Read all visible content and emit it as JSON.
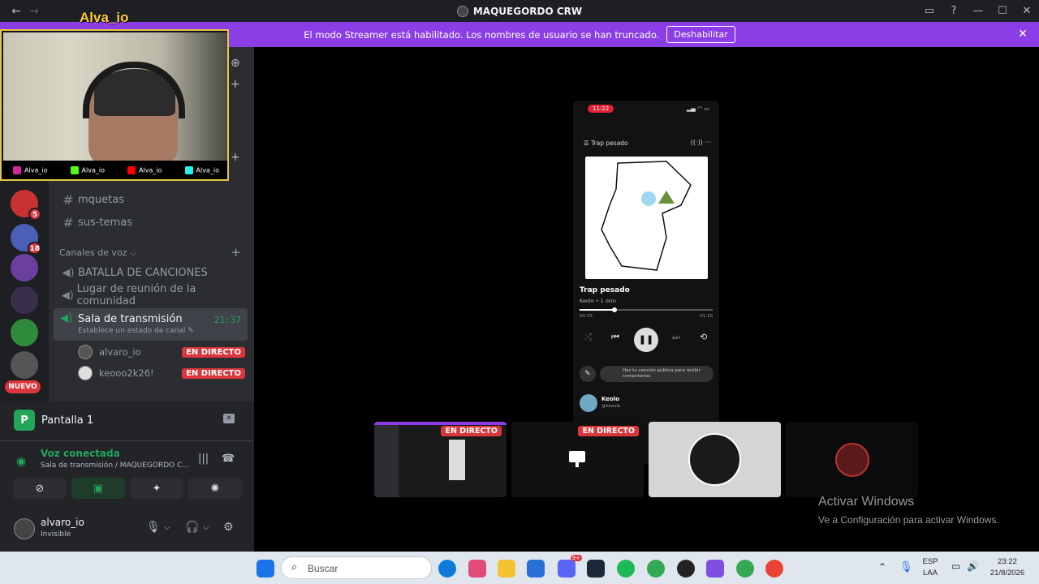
{
  "window": {
    "title": "MAQUEGORDO CRW",
    "back": "←",
    "forward": "→",
    "controls": [
      "▭",
      "?",
      "—",
      "☐",
      "✕"
    ]
  },
  "overlay": {
    "brand": "Alva_io",
    "socials": [
      "Alva_io",
      "Alva_io",
      "Alva_io",
      "Alva_io"
    ]
  },
  "banner": {
    "text": "El modo Streamer está habilitado. Los nombres de usuario se han truncado.",
    "button": "Deshabilitar",
    "close": "✕"
  },
  "servers": {
    "badges": [
      "5",
      "18"
    ],
    "new_label": "NUEVO"
  },
  "channels": {
    "text": [
      {
        "name": "mquetas"
      },
      {
        "name": "sus-temas"
      }
    ],
    "voice_category": "Canales de voz ⌵",
    "add": "+",
    "voice": [
      {
        "name": "BATALLA DE CANCIONES"
      },
      {
        "name": "Lugar de reunión de la comunidad"
      }
    ],
    "active": {
      "name": "Sala de transmisión",
      "time": "21:37",
      "status": "Establece un estado de canal ✎"
    },
    "members": [
      {
        "name": "alvaro_io",
        "badge": "EN DIRECTO"
      },
      {
        "name": "keooo2k26!",
        "badge": "EN DIRECTO"
      }
    ]
  },
  "panel": {
    "screen_label": "Pantalla 1",
    "screen_icon": "P",
    "voice_status": "Voz conectada",
    "voice_location": "Sala de transmisión / MAQUEGORDO C...",
    "user_name": "alvaro_io",
    "user_status": "Invisible"
  },
  "phone": {
    "clock": "11:22",
    "playlist": "Trap pesado",
    "song": "Trap pesado",
    "artist": "Keolo • 1 otro",
    "progress": 0.26,
    "time_elapsed": "00:33",
    "time_total": "01:10",
    "comment_hint": "Haz tu canción pública para recibir comentarios",
    "uploader_name": "Keolo",
    "uploader_handle": "@keoolo"
  },
  "tiles": [
    {
      "badge": "EN DIRECTO"
    },
    {
      "badge": "EN DIRECTO"
    },
    {
      "badge": ""
    },
    {
      "badge": ""
    }
  ],
  "watermark": {
    "title": "Activar Windows",
    "subtitle": "Ve a Configuración para activar Windows."
  },
  "taskbar": {
    "search_placeholder": "Buscar",
    "lang_top": "ESP",
    "lang_bottom": "LAA",
    "time": "23:22",
    "date": "21/8/2026",
    "discord_badge": "9+"
  },
  "colors": {
    "banner": "#8b3ee6",
    "live": "#da373c",
    "connected": "#23a55a",
    "sidebar": "#2b2d31"
  }
}
